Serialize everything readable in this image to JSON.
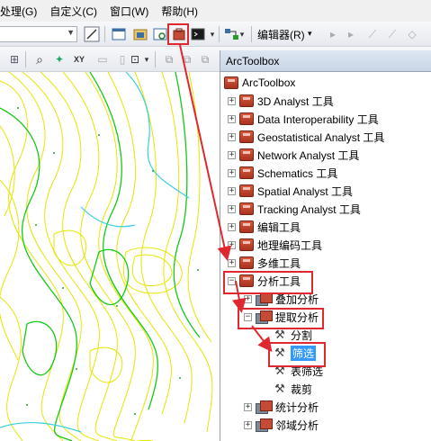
{
  "menu": [
    "处理(G)",
    "自定义(C)",
    "窗口(W)",
    "帮助(H)"
  ],
  "toolbar": {
    "editor_label": "编辑器(R)",
    "editor_arrow": "▾"
  },
  "panel": {
    "title": "ArcToolbox",
    "root": "ArcToolbox",
    "toolboxes": [
      "3D Analyst 工具",
      "Data Interoperability 工具",
      "Geostatistical Analyst 工具",
      "Network Analyst 工具",
      "Schematics 工具",
      "Spatial Analyst 工具",
      "Tracking Analyst 工具",
      "编辑工具",
      "地理编码工具",
      "多维工具"
    ],
    "analysis": {
      "label": "分析工具",
      "toolsets": [
        {
          "label": "叠加分析"
        },
        {
          "label": "提取分析",
          "tools": [
            "分割",
            "筛选",
            "表筛选",
            "裁剪"
          ]
        },
        {
          "label": "统计分析"
        },
        {
          "label": "邻域分析"
        }
      ]
    },
    "expand_plus": "+",
    "expand_minus": "−"
  },
  "colors": {
    "annotation_red": "#e0282f",
    "selection": "#3399ff",
    "contour": "#e6e600",
    "green_line": "#16c916",
    "cyan_line": "#38d1e0"
  }
}
